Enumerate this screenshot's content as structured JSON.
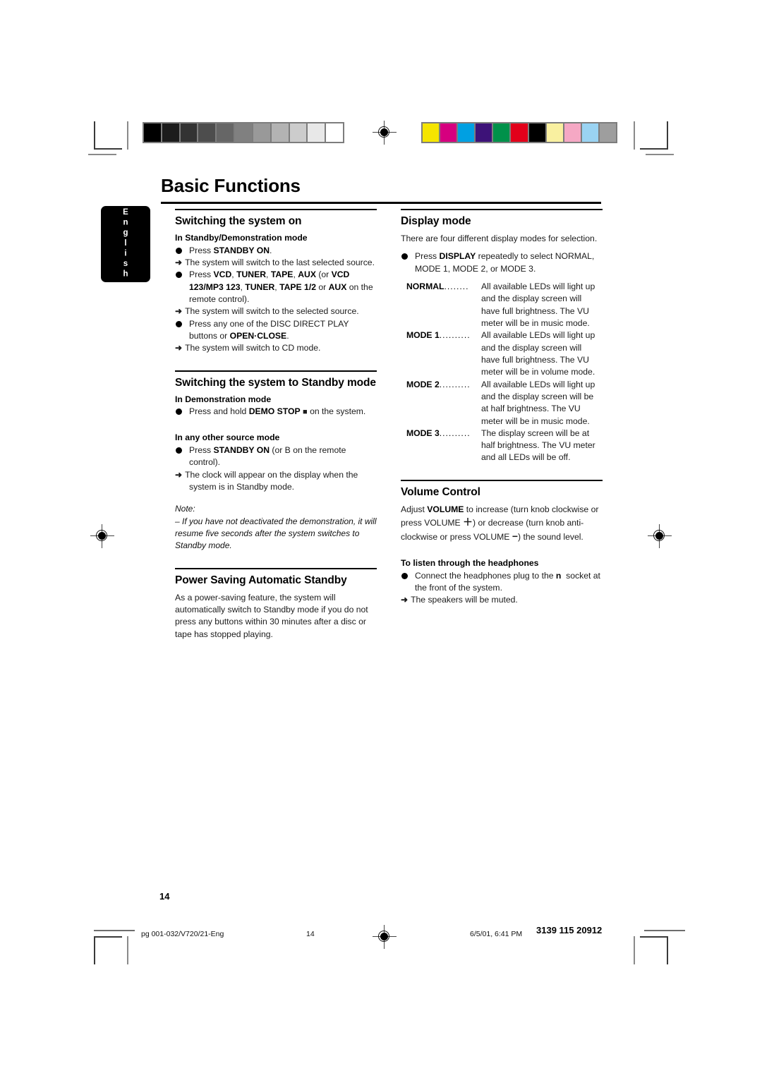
{
  "page": {
    "title": "Basic Functions",
    "language_tab": "English",
    "folio": "14"
  },
  "calibration": {
    "grayscale": [
      "#000000",
      "#1c1c1c",
      "#333333",
      "#4d4d4d",
      "#666666",
      "#808080",
      "#999999",
      "#b3b3b3",
      "#cccccc",
      "#e8e8e8",
      "#ffffff"
    ],
    "colors": [
      "#f5e500",
      "#d6007f",
      "#00a0e2",
      "#3d1278",
      "#00914a",
      "#e2001a",
      "#000000",
      "#f9f0a0",
      "#f5a8c4",
      "#9ad3f2",
      "#9e9e9e"
    ]
  },
  "left_column": {
    "section1": {
      "heading": "Switching the system on",
      "subhead": "In Standby/Demonstration mode",
      "items": [
        {
          "bullet_pre": "Press ",
          "bullet_bold": "STANDBY ON",
          "bullet_post": ".",
          "arrow": "The system will switch to the last selected source."
        }
      ],
      "item2": {
        "pre": "Press ",
        "bold1": "VCD",
        "mid1": ", ",
        "bold2": "TUNER",
        "mid2": ", ",
        "bold3": "TAPE",
        "mid3": ", ",
        "bold4": "AUX",
        "mid4": " (or ",
        "bold5": "VCD 123/MP3 123",
        "mid5": ", ",
        "bold6": "TUNER",
        "mid6": ", ",
        "bold7": "TAPE 1/2",
        "mid7": " or ",
        "bold8": "AUX",
        "post": " on the remote control).",
        "arrow": "The system will switch to the selected source."
      },
      "item3": {
        "pre": "Press any one of the DISC DIRECT PLAY buttons or ",
        "bold": "OPEN·CLOSE",
        "post": ".",
        "arrow": "The system will switch to CD mode."
      }
    },
    "section2": {
      "heading": "Switching the system to Standby mode",
      "subhead1": "In Demonstration mode",
      "item1": {
        "pre": "Press and hold ",
        "bold": "DEMO STOP",
        "glyph": "■",
        "post": "on the system."
      },
      "subhead2": "In any other source mode",
      "item2": {
        "pre": "Press ",
        "bold": "STANDBY ON",
        "mid": " (or ",
        "glyph": "B",
        "post": "on the remote control).",
        "arrow": "The clock will appear on the display when the system is in Standby mode."
      },
      "note_label": "Note:",
      "note_text": "–  If you have not deactivated the demonstration, it will resume five seconds after the system switches to Standby mode."
    },
    "section3": {
      "heading": "Power Saving Automatic Standby",
      "body": "As a power-saving feature, the system will automatically switch to Standby mode if you do not press any buttons within 30 minutes after a disc or tape has stopped playing."
    }
  },
  "right_column": {
    "section1": {
      "heading": "Display mode",
      "intro": "There are four different display modes for selection.",
      "bullet": {
        "pre": "Press ",
        "bold": "DISPLAY",
        "post": " repeatedly to select NORMAL, MODE 1, MODE 2, or MODE 3."
      },
      "modes": [
        {
          "term": "NORMAL",
          "leader": "........",
          "desc": "All available LEDs will light up and the display screen will have full brightness. The VU meter will be in music mode."
        },
        {
          "term": "MODE 1",
          "leader": "..........",
          "desc": "All available LEDs will light up and the display screen will have full brightness. The VU meter will be in volume mode."
        },
        {
          "term": "MODE 2",
          "leader": "..........",
          "desc": "All available LEDs will light up and the display screen will be at half brightness. The VU meter will be in music mode."
        },
        {
          "term": "MODE 3",
          "leader": "..........",
          "desc": "The display screen will be at half brightness. The VU meter and all LEDs will be off."
        }
      ]
    },
    "section2": {
      "heading": "Volume Control",
      "body_pre": "Adjust ",
      "body_bold": "VOLUME",
      "body_mid1": " to increase (turn knob clockwise or press VOLUME ",
      "plus": "＋",
      "body_mid2": ") or decrease (turn knob anti-clockwise or press VOLUME ",
      "minus": "−",
      "body_post": ") the sound level.",
      "subhead": "To listen through the headphones",
      "item": {
        "pre": "Connect the headphones plug to the ",
        "glyph": "n",
        "post": "socket at the front of the system.",
        "arrow": "The speakers will be muted."
      }
    }
  },
  "footer": {
    "file_ref": "pg 001-032/V720/21-Eng",
    "page_num": "14",
    "timestamp": "6/5/01, 6:41 PM",
    "doc_code": "3139 115 20912"
  }
}
